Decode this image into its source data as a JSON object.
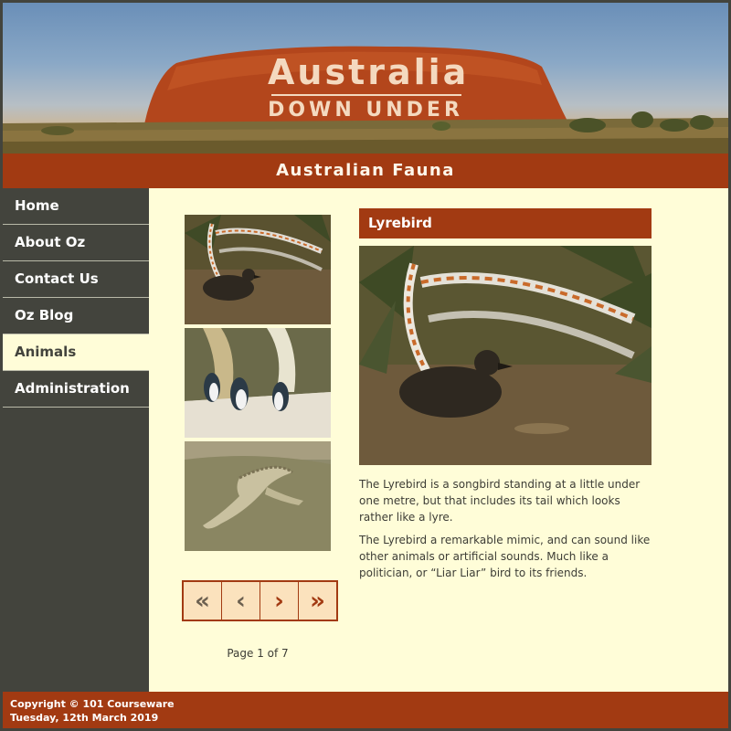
{
  "banner": {
    "title": "Australia",
    "subtitle": "DOWN UNDER"
  },
  "section": {
    "title": "Australian Fauna"
  },
  "nav": {
    "items": [
      {
        "label": "Home"
      },
      {
        "label": "About Oz"
      },
      {
        "label": "Contact Us"
      },
      {
        "label": "Oz Blog"
      },
      {
        "label": "Animals",
        "active": true
      },
      {
        "label": "Administration"
      }
    ]
  },
  "gallery": {
    "thumbnails": [
      {
        "icon": "lyrebird-photo"
      },
      {
        "icon": "penguins-photo"
      },
      {
        "icon": "crocodile-photo"
      }
    ],
    "pager": {
      "first": "«",
      "prev": "‹",
      "next": "›",
      "last": "»"
    },
    "page_info": "Page 1 of 7"
  },
  "detail": {
    "title": "Lyrebird",
    "image_icon": "lyrebird-photo",
    "paragraphs": [
      "The Lyrebird is a songbird standing at a little under one metre, but that includes its tail which looks rather like a lyre.",
      "The Lyrebird a remarkable mimic, and can sound like other animals or artificial sounds. Much like a politician, or “Liar Liar” bird to its friends."
    ]
  },
  "footer": {
    "copyright": "Copyright © 101 Courseware",
    "date": "Tuesday, 12th March 2019"
  },
  "colors": {
    "accent": "#a23a12",
    "sidebar": "#43443d",
    "content_bg": "#fffdd8",
    "pager_button": "#fbe2bd"
  }
}
